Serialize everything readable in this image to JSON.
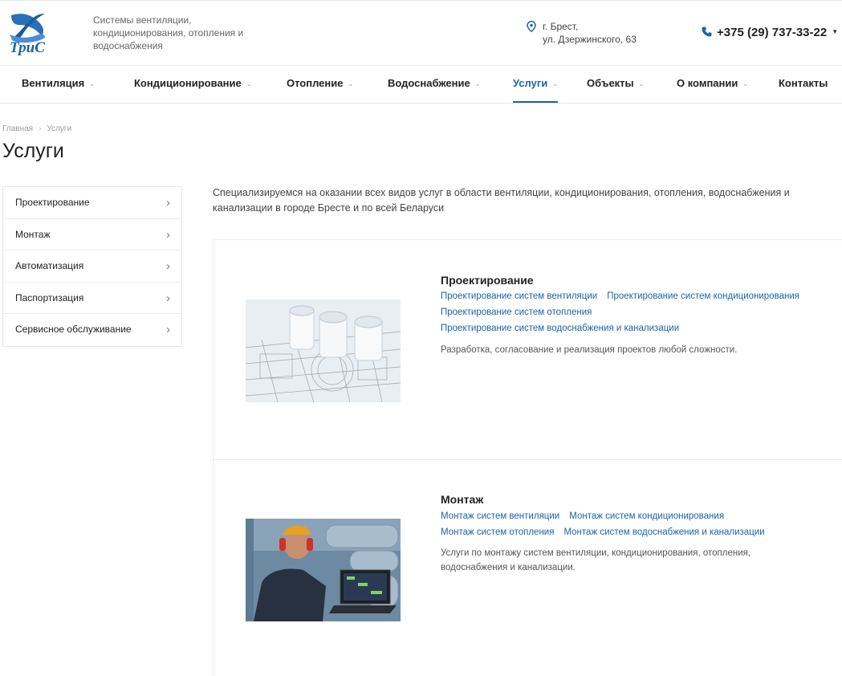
{
  "header": {
    "logo_text": "ТриС",
    "tagline": "Системы вентиляции, кондиционирования, отопления и водоснабжения",
    "address_line1": "г. Брест,",
    "address_line2": "ул. Дзержинского, 63",
    "phone": "+375 (29) 737-33-22"
  },
  "nav": {
    "items": [
      {
        "label": "Вентиляция"
      },
      {
        "label": "Кондиционирование"
      },
      {
        "label": "Отопление"
      },
      {
        "label": "Водоснабжение"
      },
      {
        "label": "Услуги"
      },
      {
        "label": "Объекты"
      },
      {
        "label": "О компании"
      },
      {
        "label": "Контакты"
      }
    ]
  },
  "breadcrumb": {
    "home": "Главная",
    "current": "Услуги"
  },
  "page_title": "Услуги",
  "sidebar": {
    "items": [
      {
        "label": "Проектирование"
      },
      {
        "label": "Монтаж"
      },
      {
        "label": "Автоматизация"
      },
      {
        "label": "Паспортизация"
      },
      {
        "label": "Сервисное обслуживание"
      }
    ]
  },
  "intro": "Специализируемся на оказании всех видов услуг в области вентиляции, кондиционирования, отопления, водоснабжения и канализации в городе Бресте и по всей Беларуси",
  "services": [
    {
      "title": "Проектирование",
      "links": [
        "Проектирование систем вентиляции",
        "Проектирование систем кондиционирования",
        "Проектирование систем отопления",
        "Проектирование систем водоснабжения и канализации"
      ],
      "description": "Разработка, согласование и реализация проектов любой сложности."
    },
    {
      "title": "Монтаж",
      "links": [
        "Монтаж систем вентиляции",
        "Монтаж систем кондиционирования",
        "Монтаж систем отопления",
        "Монтаж систем водоснабжения и канализации"
      ],
      "description": "Услуги по монтажу систем вентиляции, кондиционирования, отопления, водоснабжения и канализации."
    }
  ],
  "colors": {
    "accent": "#1a64a8",
    "text": "#222222",
    "border": "#ececec"
  }
}
